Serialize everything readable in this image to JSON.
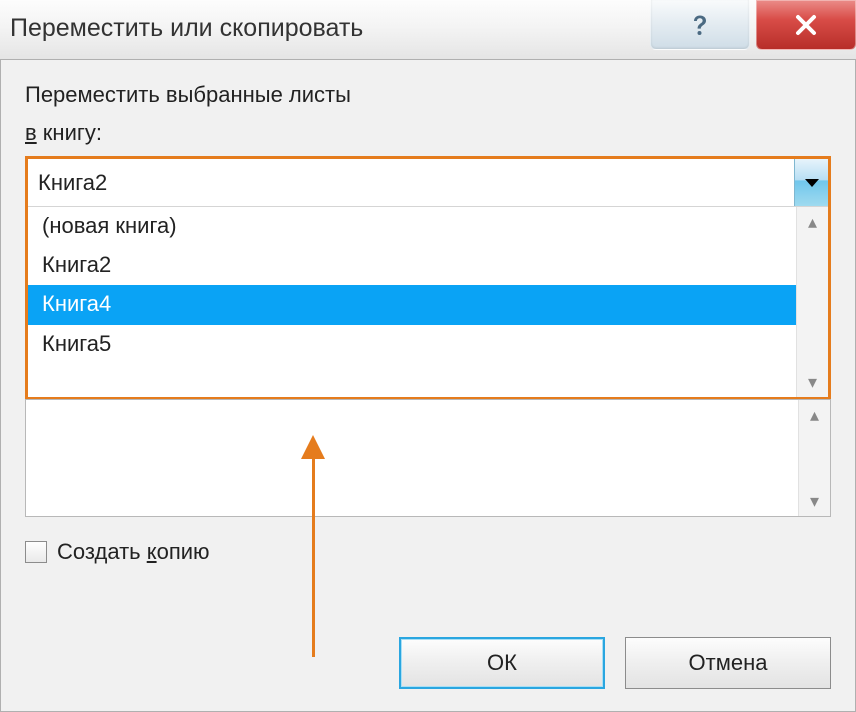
{
  "titlebar": {
    "title": "Переместить или скопировать"
  },
  "instruction": "Переместить выбранные листы",
  "book_label_underlined": "в",
  "book_label_rest": " книгу:",
  "combo": {
    "value": "Книга2"
  },
  "dropdown": {
    "items": [
      "(новая книга)",
      "Книга2",
      "Книга4",
      "Книга5"
    ],
    "selected_index": 2
  },
  "checkbox": {
    "label_underlined": "к",
    "label_before": "Создать ",
    "label_after": "опию"
  },
  "buttons": {
    "ok": "ОК",
    "cancel": "Отмена"
  },
  "scroll": {
    "up": "▴",
    "down": "▾"
  }
}
